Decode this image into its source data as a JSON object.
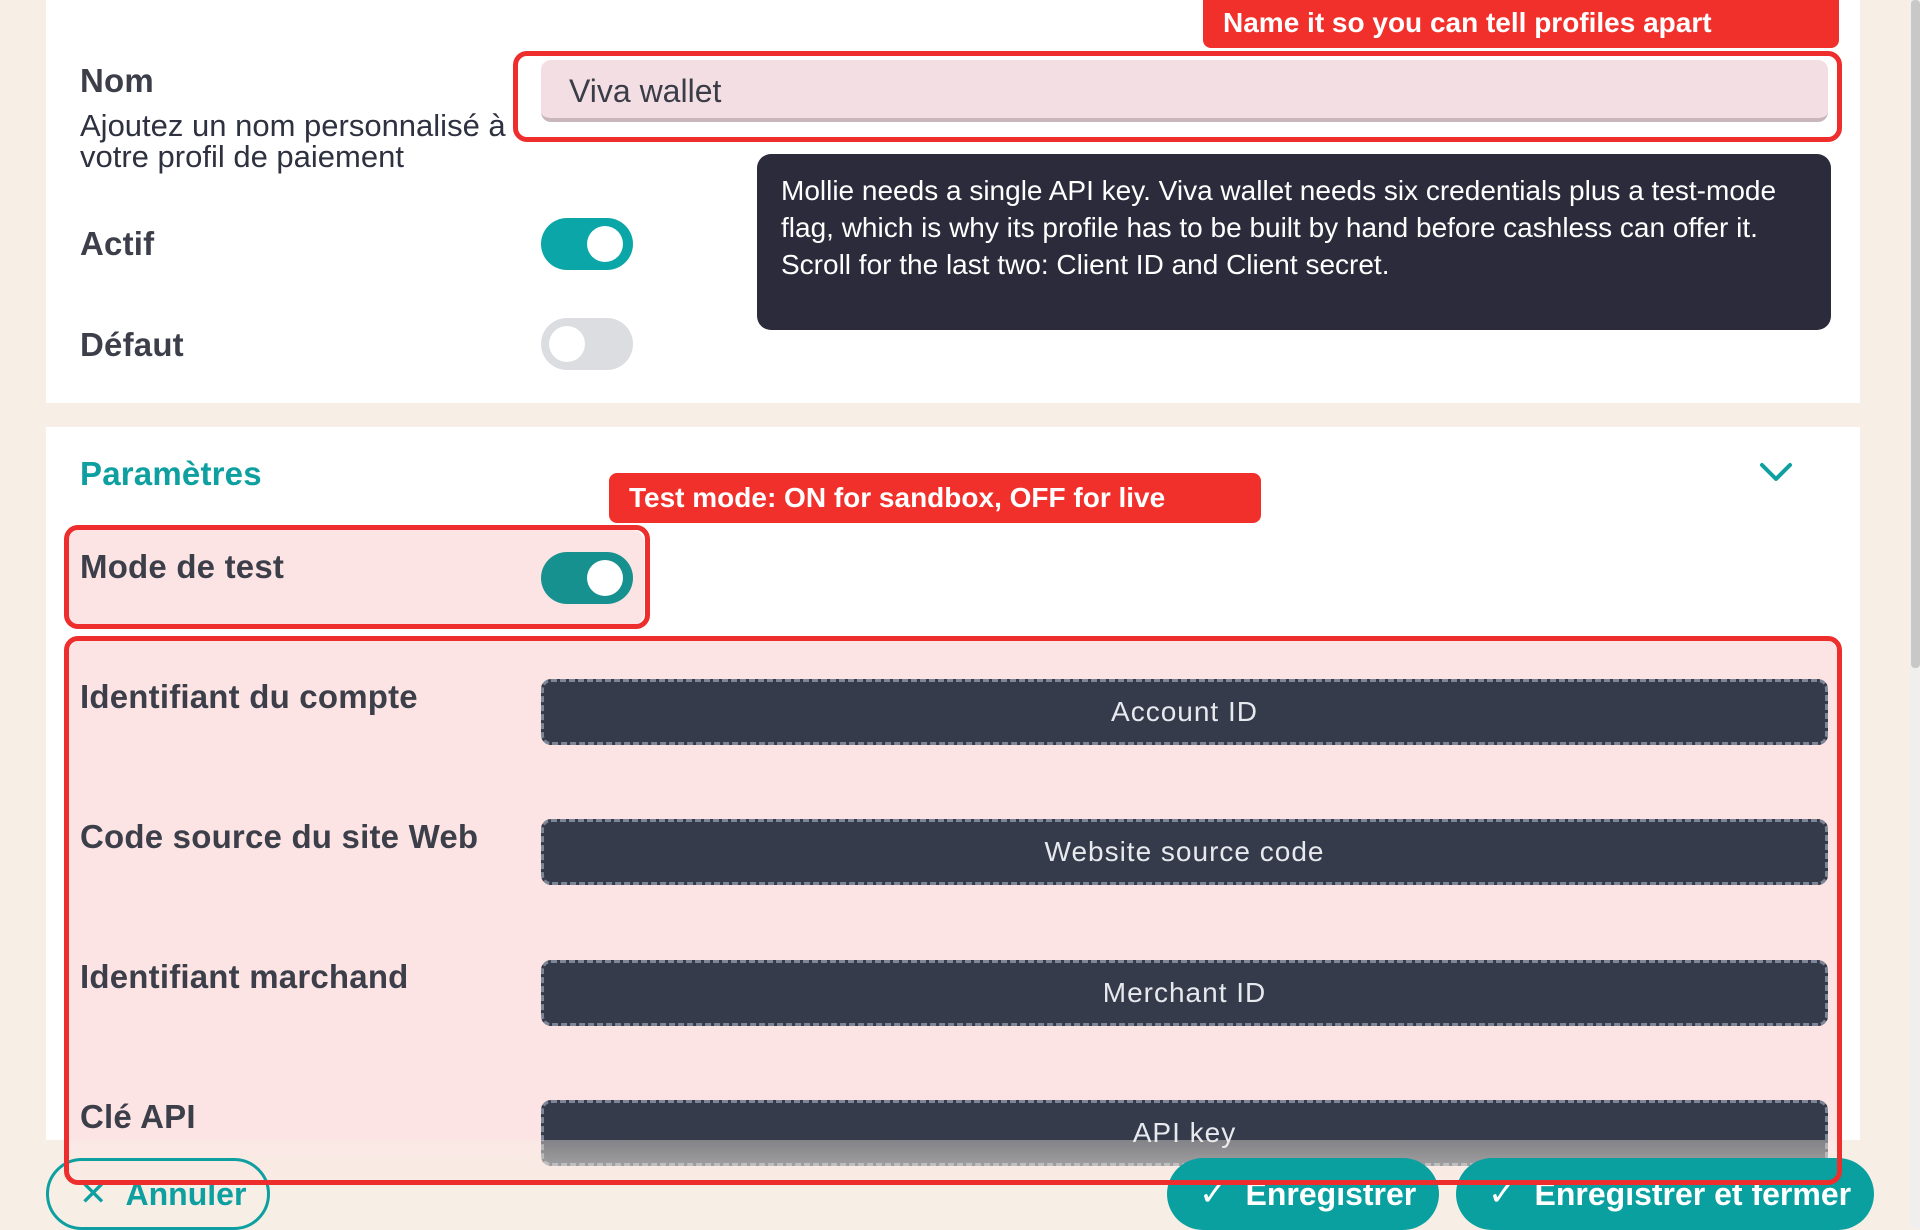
{
  "profile": {
    "name_label": "Nom",
    "name_help": "Ajoutez un nom personnalisé à votre profil de paiement",
    "name_value": "Viva wallet",
    "active_label": "Actif",
    "active_on": true,
    "default_label": "Défaut",
    "default_on": false
  },
  "settings": {
    "section_title": "Paramètres",
    "test_mode_label": "Mode de test",
    "test_mode_on": true,
    "fields": [
      {
        "label": "Identifiant du compte",
        "placeholder": "Account ID"
      },
      {
        "label": "Code source du site Web",
        "placeholder": "Website source code"
      },
      {
        "label": "Identifiant marchand",
        "placeholder": "Merchant ID"
      },
      {
        "label": "Clé API",
        "placeholder": "API key"
      }
    ]
  },
  "annotations": {
    "name_tag": "Name it so you can tell profiles apart",
    "test_tag": "Test mode: ON for sandbox, OFF for live",
    "tooltip": "Mollie needs a single API key. Viva wallet needs six credentials plus a test-mode flag, which is why its profile has to be built by hand before cashless can offer it. Scroll for the last two: Client ID and Client secret."
  },
  "footer": {
    "cancel_label": "Annuler",
    "save_label": "Enregistrer",
    "save_close_label": "Enregistrer et fermer"
  },
  "colors": {
    "accent": "#0aa0a0",
    "toggle_off": "#dcdde1",
    "annotation_red": "#f1302c",
    "credential_bg": "#353b4a"
  },
  "icons": {
    "section_toggle": "chevron-down-icon",
    "cancel": "close-icon",
    "save": "check-icon"
  }
}
